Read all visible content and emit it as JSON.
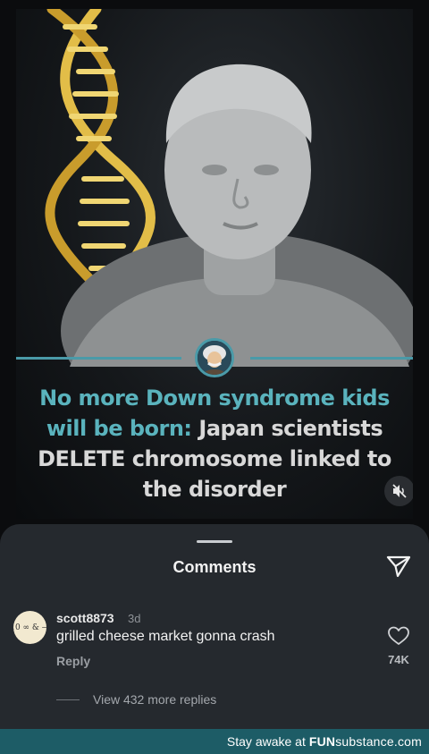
{
  "post": {
    "headline": {
      "highlight": "No more Down syndrome kids will be born:",
      "rest": " Japan scientists DELETE chromosome linked to the disorder"
    },
    "mute_icon": "speaker-muted-icon",
    "badge_icon": "einstein-avatar-icon"
  },
  "comments_sheet": {
    "title": "Comments",
    "share_icon": "paper-plane-icon",
    "comments": [
      {
        "avatar_text": "10 ∞ & —",
        "username": "scott8873",
        "age": "3d",
        "text": "grilled cheese market gonna crash",
        "reply_label": "Reply",
        "like_icon": "heart-outline-icon",
        "likes": "74K"
      }
    ],
    "view_replies": "View 432 more replies"
  },
  "footer": {
    "prefix": "Stay awake at",
    "brand_fun": "FUN",
    "brand_sub": "substance",
    "brand_com": ".com"
  },
  "colors": {
    "accent_teal": "#5ab3bd",
    "footer_bg": "#1d5c66",
    "sheet_bg": "#25292e"
  }
}
